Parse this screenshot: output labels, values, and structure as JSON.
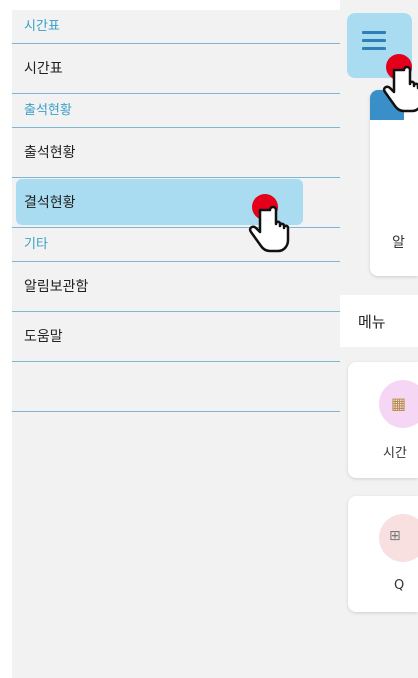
{
  "drawer": {
    "sections": [
      {
        "header": "시간표",
        "items": [
          {
            "label": "시간표",
            "highlighted": false
          }
        ]
      },
      {
        "header": "출석현황",
        "items": [
          {
            "label": "출석현황",
            "highlighted": false
          },
          {
            "label": "결석현황",
            "highlighted": true
          }
        ]
      },
      {
        "header": "기타",
        "items": [
          {
            "label": "알림보관함",
            "highlighted": false
          },
          {
            "label": "도움말",
            "highlighted": false
          }
        ]
      }
    ]
  },
  "background": {
    "card1_text": "알",
    "menu_label": "메뉴",
    "card2_text": "시간",
    "card3_text": "Q"
  },
  "colors": {
    "accent": "#3aa0c8",
    "highlight": "#a9dcf1",
    "divider": "#7fb6d6",
    "tap_dot": "#e4001b"
  }
}
